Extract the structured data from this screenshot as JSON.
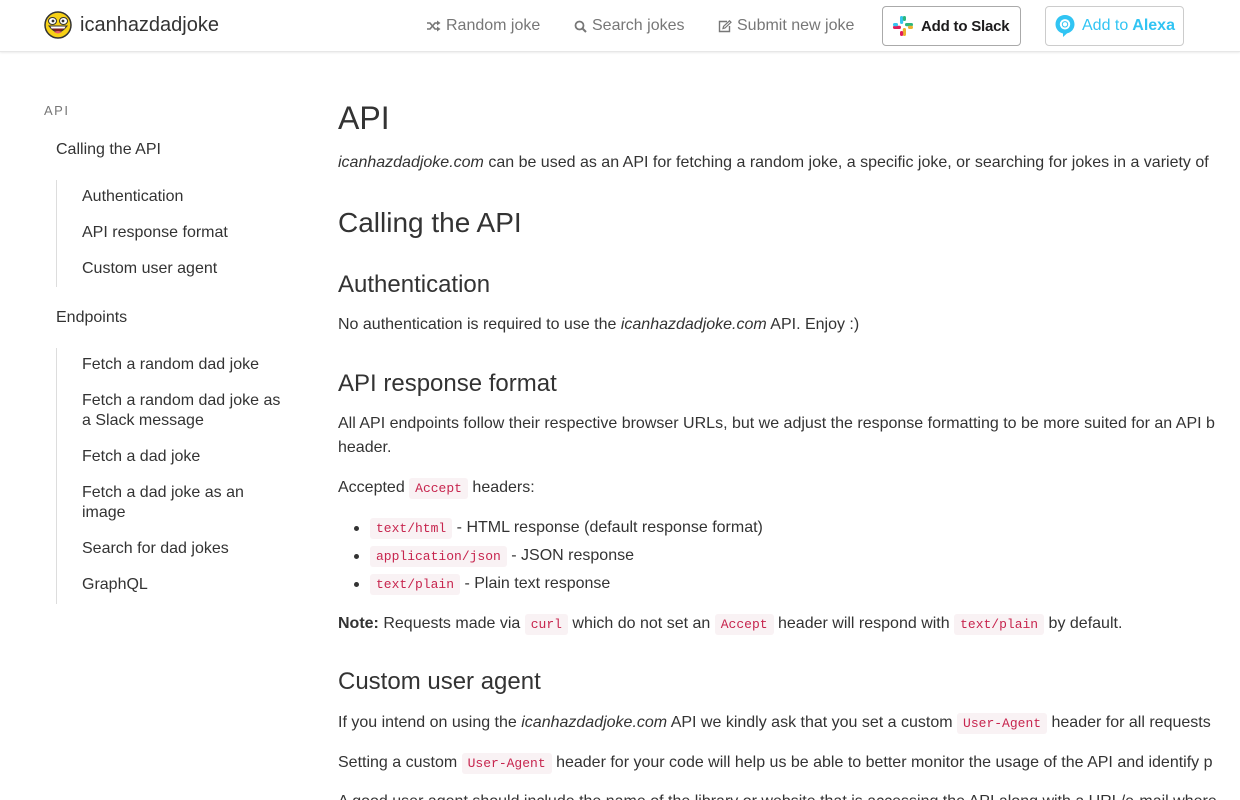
{
  "nav": {
    "brand": "icanhazdadjoke",
    "links": [
      {
        "label": "Random joke",
        "icon": "shuffle-icon"
      },
      {
        "label": "Search jokes",
        "icon": "search-icon"
      },
      {
        "label": "Submit new joke",
        "icon": "edit-icon"
      }
    ],
    "slack_label": "Add to Slack",
    "alexa_prefix": "Add to",
    "alexa_name": "Alexa"
  },
  "sidebar": {
    "heading": "API",
    "sections": [
      {
        "label": "Calling the API",
        "items": [
          "Authentication",
          "API response format",
          "Custom user agent"
        ]
      },
      {
        "label": "Endpoints",
        "items": [
          "Fetch a random dad joke",
          "Fetch a random dad joke as a Slack message",
          "Fetch a dad joke",
          "Fetch a dad joke as an image",
          "Search for dad jokes",
          "GraphQL"
        ]
      }
    ]
  },
  "content": {
    "title": "API",
    "intro_site": "icanhazdadjoke.com",
    "intro_rest": " can be used as an API for fetching a random joke, a specific joke, or searching for jokes in a variety of",
    "calling_title": "Calling the API",
    "auth_title": "Authentication",
    "auth_pre": "No authentication is required to use the ",
    "auth_site": "icanhazdadjoke.com",
    "auth_post": " API. Enjoy :)",
    "format_title": "API response format",
    "format_line1": "All API endpoints follow their respective browser URLs, but we adjust the response formatting to be more suited for an API b",
    "format_line2": "header.",
    "accepted_pre": "Accepted ",
    "accepted_code": "Accept",
    "accepted_post": " headers:",
    "formats": [
      {
        "code": "text/html",
        "desc": " - HTML response (default response format)"
      },
      {
        "code": "application/json",
        "desc": " - JSON response"
      },
      {
        "code": "text/plain",
        "desc": " - Plain text response"
      }
    ],
    "note_label": "Note:",
    "note_a": " Requests made via ",
    "note_code1": "curl",
    "note_b": " which do not set an ",
    "note_code2": "Accept",
    "note_c": " header will respond with ",
    "note_code3": "text/plain",
    "note_d": " by default.",
    "ua_title": "Custom user agent",
    "ua_p1_pre": "If you intend on using the ",
    "ua_p1_site": "icanhazdadjoke.com",
    "ua_p1_mid": " API we kindly ask that you set a custom ",
    "ua_p1_code": "User-Agent",
    "ua_p1_post": " header for all requests",
    "ua_p2_pre": "Setting a custom ",
    "ua_p2_code": "User-Agent",
    "ua_p2_post": " header for your code will help us be able to better monitor the usage of the API and identify p",
    "ua_p3": "A good user agent should include the name of the library or website that is accessing the API along with a URL/e-mail where"
  }
}
